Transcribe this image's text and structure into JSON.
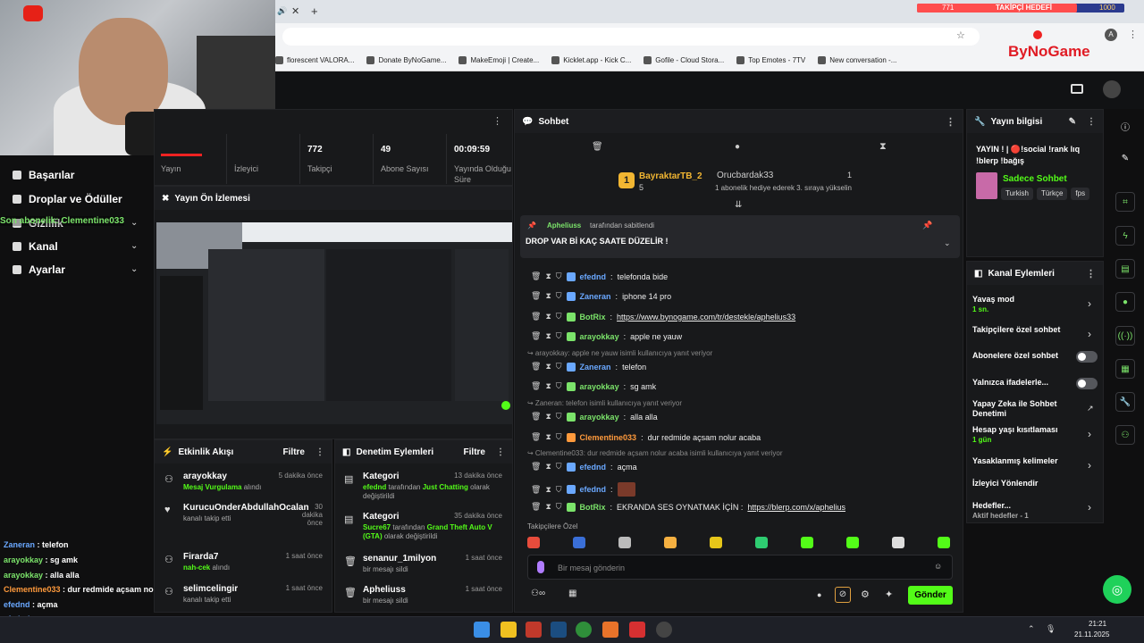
{
  "overlay": {
    "follower_goal_label": "TAKİPÇİ HEDEFİ",
    "follower_goal_current": "771",
    "follower_goal_target": "1000",
    "follower_goal_progress": 0.771,
    "chat": [
      {
        "user": "Zaneran",
        "text": "telefon",
        "color": "#6aa8ff"
      },
      {
        "user": "arayokkay",
        "text": "sg amk",
        "color": "#7be36a"
      },
      {
        "user": "arayokkay",
        "text": "alla alla",
        "color": "#7be36a"
      },
      {
        "user": "Clementine033",
        "text": "dur redmide açsam nolur acaba",
        "color": "#ff9a3c"
      },
      {
        "user": "efednd",
        "text": "açma",
        "color": "#6aa8ff"
      },
      {
        "user": "efednd",
        "text": "",
        "color": "#6aa8ff"
      }
    ],
    "ticker": "Son abonelik: Clementine033"
  },
  "browser": {
    "bookmarks": [
      "florescent VALORA...",
      "Donate ByNoGame...",
      "MakeEmoji | Create...",
      "Kicklet.app - Kick C...",
      "Gofile - Cloud Stora...",
      "Top Emotes - 7TV",
      "New conversation -..."
    ],
    "brand": "ByNoGame"
  },
  "sidebar": {
    "items": [
      {
        "label": "Başarılar",
        "icon": "trophy-icon"
      },
      {
        "label": "Droplar ve Ödüller",
        "icon": "gift-icon"
      },
      {
        "label": "Gizlilik",
        "icon": "lock-icon"
      },
      {
        "label": "Kanal",
        "icon": "broadcast-icon"
      },
      {
        "label": "Ayarlar",
        "icon": "gear-icon"
      }
    ]
  },
  "stats": [
    {
      "value": "",
      "label": "Yayın"
    },
    {
      "value": "",
      "label": "İzleyici"
    },
    {
      "value": "772",
      "label": "Takipçi"
    },
    {
      "value": "49",
      "label": "Abone Sayısı"
    },
    {
      "value": "00:09:59",
      "label": "Yayında Olduğu Süre"
    }
  ],
  "preview": {
    "title": "Yayın Ön İzlemesi"
  },
  "activity": {
    "title": "Etkinlik Akışı",
    "filter": "Filtre",
    "items": [
      {
        "name": "arayokkay",
        "detail_hl": "Mesaj Vurgulama",
        "detail": "alındı",
        "time": "5 dakika önce"
      },
      {
        "name": "KurucuOnderAbdullahOcalan",
        "detail_hl": "",
        "detail": "kanalı takip etti",
        "time": "30 dakika önce"
      },
      {
        "name": "Firarda7",
        "detail_hl": "nah-cek",
        "detail": "alındı",
        "time": "1 saat önce"
      },
      {
        "name": "selimcelingir",
        "detail_hl": "",
        "detail": "kanalı takip etti",
        "time": "1 saat önce"
      }
    ]
  },
  "moderation": {
    "title": "Denetim Eylemleri",
    "filter": "Filtre",
    "items": [
      {
        "title": "Kategori",
        "line1_user": "efednd",
        "line1_mid": "tarafından",
        "line1_hl": "Just Chatting",
        "line1_end": "olarak",
        "line2": "değiştirildi",
        "time": "13 dakika önce"
      },
      {
        "title": "Kategori",
        "line1_user": "Sucre67",
        "line1_mid": "tarafından",
        "line1_hl": "Grand Theft Auto V (GTA)",
        "line1_end": "olarak değiştirildi",
        "line2": "",
        "time": "35 dakika önce"
      },
      {
        "title": "senanur_1milyon",
        "line1_user": "",
        "line1_mid": "bir mesajı sildi",
        "line1_hl": "",
        "line1_end": "",
        "line2": "",
        "time": "1 saat önce"
      },
      {
        "title": "Apheliuss",
        "line1_user": "",
        "line1_mid": "bir mesajı sildi",
        "line1_hl": "",
        "line1_end": "",
        "line2": "",
        "time": "1 saat önce"
      }
    ]
  },
  "chat": {
    "title": "Sohbet",
    "top_gifter": {
      "name": "BayraktarTB_2",
      "count": "5",
      "rank": "1"
    },
    "gift_user": "Orucbardak33",
    "gift_count": "1",
    "gift_text": "1 abonelik hediye ederek 3. sıraya yükselin",
    "pinned_by": "Apheliuss",
    "pinned_suffix": "tarafından sabitlendi",
    "pinned_text": "DROP VAR Bİ KAÇ SAATE DÜZELİR !",
    "messages": [
      {
        "user": "efednd",
        "text": "telefonda bide",
        "color": "#6aa8ff",
        "reply": ""
      },
      {
        "user": "Zaneran",
        "text": "iphone 14 pro",
        "color": "#6aa8ff",
        "reply": ""
      },
      {
        "user": "BotRix",
        "text": "https://www.bynogame.com/tr/destekle/aphelius33",
        "color": "#7be36a",
        "reply": ""
      },
      {
        "user": "arayokkay",
        "text": "apple ne yauw",
        "color": "#7be36a",
        "reply": ""
      },
      {
        "user": "Zaneran",
        "text": "telefon",
        "color": "#6aa8ff",
        "reply": "arayokkay: apple ne yauw isimli kullanıcıya yanıt veriyor"
      },
      {
        "user": "arayokkay",
        "text": "sg amk",
        "color": "#7be36a",
        "reply": ""
      },
      {
        "user": "arayokkay",
        "text": "alla alla",
        "color": "#7be36a",
        "reply": "Zaneran: telefon isimli kullanıcıya yanıt veriyor"
      },
      {
        "user": "Clementine033",
        "text": "dur redmide açsam nolur acaba",
        "color": "#ff9a3c",
        "reply": ""
      },
      {
        "user": "efednd",
        "text": "açma",
        "color": "#6aa8ff",
        "reply": "Clementine033: dur redmide açsam nolur acaba isimli kullanıcıya yanıt veriyor"
      },
      {
        "user": "efednd",
        "text": "",
        "color": "#6aa8ff",
        "reply": ""
      },
      {
        "user": "BotRix",
        "text": "EKRANDA SES OYNATMAK İÇİN :",
        "link": "https://blerp.com/x/aphelius",
        "color": "#7be36a",
        "reply": ""
      }
    ],
    "followers_only_label": "Takipçilere Özel",
    "input_placeholder": "Bir mesaj gönderin",
    "send_label": "Gönder"
  },
  "stream_info": {
    "title": "Yayın bilgisi",
    "stream_title": "YAYIN ! | 🔴!social !rank lıq !blerp !bağış",
    "category": "Sadece Sohbet",
    "tags": [
      "Turkish",
      "Türkçe",
      "fps"
    ]
  },
  "channel_actions": {
    "title": "Kanal Eylemleri",
    "items": [
      {
        "label": "Yavaş mod",
        "sub": "1 sn.",
        "control": "chevron"
      },
      {
        "label": "Takipçilere özel sohbet",
        "sub": "",
        "control": "chevron"
      },
      {
        "label": "Abonelere özel sohbet",
        "sub": "",
        "control": "toggle"
      },
      {
        "label": "Yalnızca ifadelerle...",
        "sub": "",
        "control": "toggle"
      },
      {
        "label": "Yapay Zeka ile Sohbet Denetimi",
        "sub": "",
        "control": "external"
      },
      {
        "label": "Hesap yaşı kısıtlaması",
        "sub": "1 gün",
        "control": "chevron"
      },
      {
        "label": "Yasaklanmış kelimeler",
        "sub": "",
        "control": "chevron"
      },
      {
        "label": "İzleyici Yönlendir",
        "sub": "",
        "control": "none"
      },
      {
        "label": "Hedefler...",
        "sub": "Aktif hedefler - 1",
        "control": "chevron"
      }
    ]
  },
  "taskbar": {
    "time": "21:21",
    "date": "21.11.2025"
  },
  "colors": {
    "accent": "#53fc18",
    "link_blue": "#6aa8ff",
    "panel_bg": "#18191b",
    "page_bg": "#0f0f10"
  }
}
